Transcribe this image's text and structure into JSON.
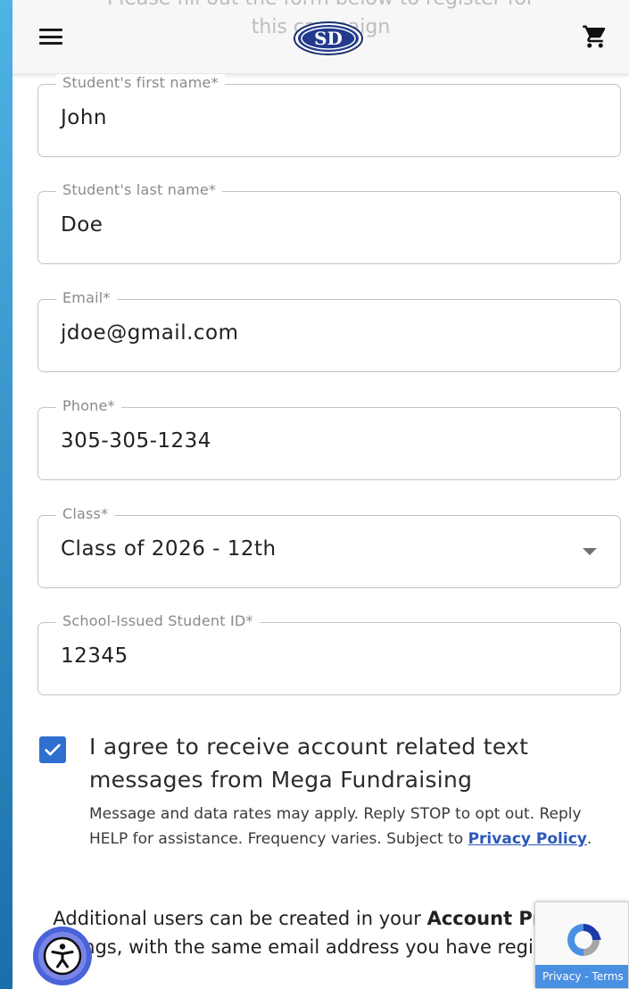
{
  "header": {
    "behind_text_line1": "Please fill out the form below to register for",
    "behind_text_line2": "this campaign",
    "logo_text": "SD",
    "menu_icon": "hamburger-menu-icon",
    "cart_icon": "shopping-cart-icon"
  },
  "form": {
    "first_name": {
      "label": "Student's first name*",
      "value": "John"
    },
    "last_name": {
      "label": "Student's last name*",
      "value": "Doe"
    },
    "email": {
      "label": "Email*",
      "value": "jdoe@gmail.com"
    },
    "phone": {
      "label": "Phone*",
      "value": "305-305-1234"
    },
    "class": {
      "label": "Class*",
      "value": "Class of 2026 - 12th"
    },
    "student_id": {
      "label": "School-Issued Student ID*",
      "value": "12345"
    }
  },
  "consent": {
    "checked": true,
    "title": "I agree to receive account related text messages from Mega Fundraising",
    "fine_print": "Message and data rates may apply. Reply STOP to opt out. Reply HELP for assistance. Frequency varies. Subject to",
    "privacy_link": "Privacy Policy",
    "end": "."
  },
  "additional": {
    "text_before": "Additional users can be created in your ",
    "account_bold": "Account Profile",
    "text_after": " settings, with the same email address you have registered."
  },
  "accessibility": {
    "icon": "accessibility-person-icon"
  },
  "recaptcha": {
    "privacy": "Privacy",
    "separator": " - ",
    "terms": "Terms"
  },
  "colors": {
    "checkbox": "#2f6fd0",
    "link": "#2b58b8",
    "accessibility_button": "#4a63d8",
    "side_gradient_top": "#4fb3e6",
    "side_gradient_bottom": "#1a6fa8"
  }
}
